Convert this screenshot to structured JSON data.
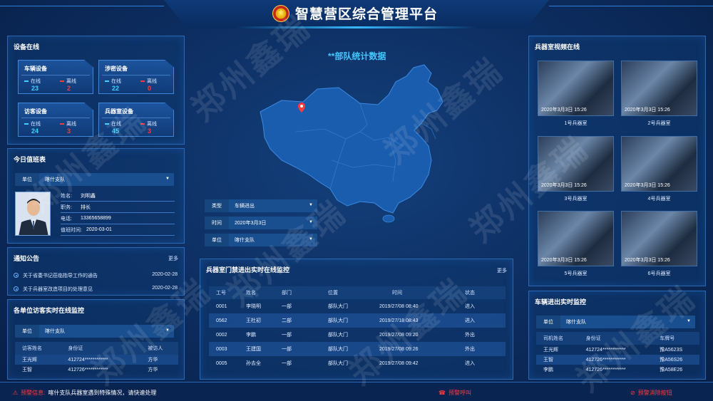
{
  "app": {
    "title": "智慧营区综合管理平台"
  },
  "devices": {
    "title": "设备在线",
    "cards": [
      {
        "name": "车辆设备",
        "online_label": "在线",
        "offline_label": "离线",
        "online": "23",
        "offline": "2"
      },
      {
        "name": "涉密设备",
        "online_label": "在线",
        "offline_label": "离线",
        "online": "22",
        "offline": "0"
      },
      {
        "name": "访客设备",
        "online_label": "在线",
        "offline_label": "离线",
        "online": "24",
        "offline": "3"
      },
      {
        "name": "兵器室设备",
        "online_label": "在线",
        "offline_label": "离线",
        "online": "45",
        "offline": "3"
      }
    ]
  },
  "duty": {
    "title": "今日值班表",
    "unit_label": "单位",
    "unit_value": "喀什支队",
    "fields": [
      {
        "key": "姓名:",
        "value": "刘明鑫"
      },
      {
        "key": "职务:",
        "value": "排长"
      },
      {
        "key": "电话:",
        "value": "13365658899"
      },
      {
        "key": "值班时间:",
        "value": "2020-03-01"
      }
    ]
  },
  "notices": {
    "title": "通知公告",
    "more": "更多",
    "items": [
      {
        "text": "关于省委书记莅临指导工作的通告",
        "date": "2020-02-28"
      },
      {
        "text": "关于兵器室改造项目的处理意见",
        "date": "2020-02-28"
      }
    ]
  },
  "visitors": {
    "title": "各单位访客实时在线监控",
    "unit_label": "单位",
    "unit_value": "喀什支队",
    "columns": [
      "访客姓名",
      "身份证",
      "被访人"
    ],
    "rows": [
      [
        "王光辉",
        "412724************",
        "方华"
      ],
      [
        "王智",
        "412726************",
        "方华"
      ]
    ]
  },
  "center": {
    "title": "**部队统计数据",
    "filters": [
      {
        "label": "类型",
        "value": "车辆进出"
      },
      {
        "label": "时间",
        "value": "2020年3月3日"
      },
      {
        "label": "单位",
        "value": "喀什支队"
      }
    ]
  },
  "armory_access": {
    "title": "兵器室门禁进出实时在线监控",
    "more": "更多",
    "columns": [
      "工号",
      "姓名",
      "部门",
      "位置",
      "时间",
      "状态"
    ],
    "rows": [
      [
        "0001",
        "李晓明",
        "一部",
        "部队大门",
        "2019/27/08 08:40",
        "进入"
      ],
      [
        "0562",
        "王杜初",
        "二部",
        "部队大门",
        "2019/27/18 08:43",
        "进入"
      ],
      [
        "0002",
        "李鹏",
        "一部",
        "部队大门",
        "2019/27/08 09:20",
        "外出"
      ],
      [
        "0003",
        "王建国",
        "一部",
        "部队大门",
        "2019/27/08 09:26",
        "外出"
      ],
      [
        "0005",
        "孙去全",
        "一部",
        "部队大门",
        "2019/27/08 09:42",
        "进入"
      ]
    ]
  },
  "video": {
    "title": "兵器室视频在线",
    "cells": [
      {
        "timestamp": "2020年3月3日 15:26",
        "label": "1号兵器室"
      },
      {
        "timestamp": "2020年3月3日 15:26",
        "label": "2号兵器室"
      },
      {
        "timestamp": "2020年3月3日 15:26",
        "label": "3号兵器室"
      },
      {
        "timestamp": "2020年3月3日 15:26",
        "label": "4号兵器室"
      },
      {
        "timestamp": "2020年3月3日 15:26",
        "label": "5号兵器室"
      },
      {
        "timestamp": "2020年3月3日 15:26",
        "label": "6号兵器室"
      }
    ]
  },
  "vehicles": {
    "title": "车辆进出实时监控",
    "unit_label": "单位",
    "unit_value": "喀什支队",
    "columns": [
      "司机姓名",
      "身份证",
      "车牌号"
    ],
    "rows": [
      [
        "王光辉",
        "412724************",
        "豫A5623S"
      ],
      [
        "王智",
        "412726************",
        "豫A56S26"
      ],
      [
        "李鹏",
        "412726************",
        "豫A58E26"
      ]
    ]
  },
  "alerts": {
    "info_label": "预警信息:",
    "info_text": "喀什支队兵器室遇到特殊情况，请快速处理",
    "call": "预警呼叫",
    "clear": "预警消除按钮"
  },
  "watermark": "郑州鑫瑞",
  "colors": {
    "accent": "#42c8ff",
    "alert": "#ff3b3b",
    "online": "#3fd2ff"
  }
}
